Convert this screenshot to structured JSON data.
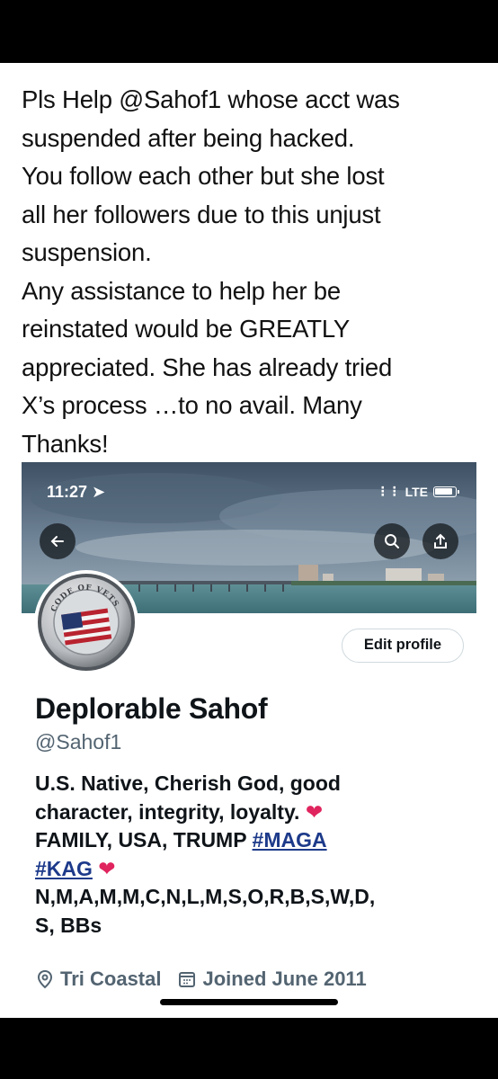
{
  "tweet": {
    "lines": [
      "Pls Help @Sahof1 whose acct was",
      "suspended after being hacked.",
      "You follow each other but she lost",
      "all her followers due to this unjust",
      "suspension.",
      "Any assistance to help her be",
      "reinstated would be GREATLY",
      "appreciated. She has already tried",
      "X’s process …to no avail. Many",
      "Thanks!"
    ]
  },
  "status_bar": {
    "time": "11:27",
    "network": "LTE"
  },
  "profile": {
    "edit_button": "Edit profile",
    "display_name": "Deplorable Sahof",
    "handle": "@Sahof1",
    "bio": {
      "line1": "U.S. Native, Cherish God, good",
      "line2": "character, integrity, loyalty.",
      "line3_prefix": "FAMILY, USA, TRUMP",
      "hashtag1": "#MAGA",
      "hashtag2": "#KAG",
      "line5": "N,M,A,M,M,C,N,L,M,S,O,R,B,S,W,D,",
      "line6": "S, BBs"
    },
    "location": "Tri Coastal",
    "joined": "Joined June 2011"
  },
  "avatar": {
    "ring_text": "CODE OF VETS"
  }
}
